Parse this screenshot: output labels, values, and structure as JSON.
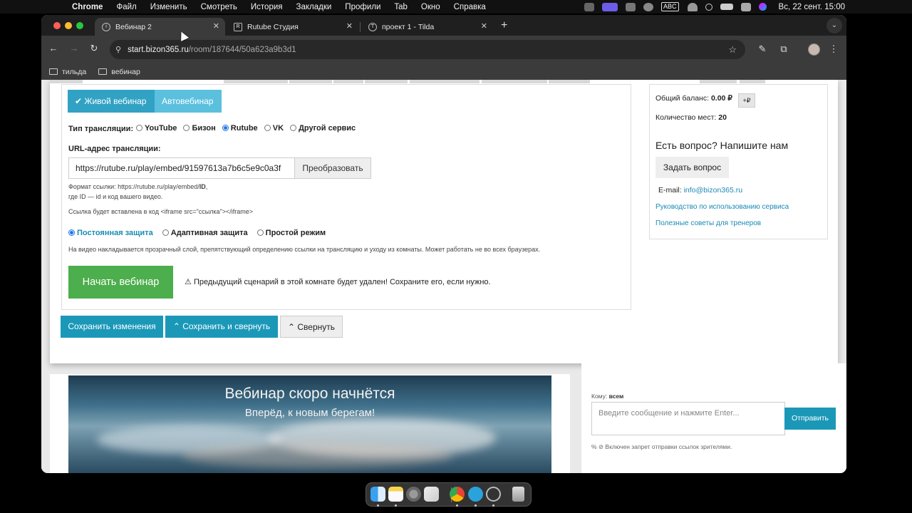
{
  "menubar": {
    "apple_glyph": "",
    "app": "Chrome",
    "items": [
      "Файл",
      "Изменить",
      "Смотреть",
      "История",
      "Закладки",
      "Профили",
      "Tab",
      "Окно",
      "Справка"
    ],
    "input_source": "ABC",
    "clock": "Вс, 22 сент.  15:00"
  },
  "browser": {
    "tabs": [
      {
        "title": "Вебинар 2",
        "favicon": "i",
        "active": true
      },
      {
        "title": "Rutube Студия",
        "favicon": "R",
        "active": false
      },
      {
        "title": "проект 1 - Tilda",
        "favicon": "T",
        "active": false
      }
    ],
    "new_tab_glyph": "+",
    "tab_close_glyph": "✕",
    "tab_search_glyph": "⌄",
    "url_host": "start.bizon365.ru",
    "url_path": "/room/187644/50a623a9b3d1",
    "bookmarks": [
      "тильда",
      "вебинар"
    ],
    "icons": {
      "back": "←",
      "forward": "→",
      "reload": "↻",
      "site": "⚲",
      "star": "☆",
      "pen": "✎",
      "extensions": "⧉",
      "menu": "⋮"
    }
  },
  "settings": {
    "mode_live": "✔ Живой вебинар",
    "mode_auto": "Автовебинар",
    "broadcast_type_label": "Тип трансляции:",
    "broadcast_options": [
      "YouTube",
      "Бизон",
      "Rutube",
      "VK",
      "Другой сервис"
    ],
    "broadcast_selected": "Rutube",
    "url_label": "URL-адрес трансляции:",
    "url_value": "https://rutube.ru/play/embed/91597613a7b6c5e9c0a3f",
    "convert_button": "Преобразовать",
    "hint_format_prefix": "Формат ссылки: https://rutube.ru/play/embed/",
    "hint_format_id": "ID",
    "hint_format_suffix": ",",
    "hint_id": "где ID — id и код вашего видео.",
    "hint_iframe": "Ссылка будет вставлена в код <iframe src=\"ссылка\"></iframe>",
    "protection_options": [
      "Постоянная защита",
      "Адаптивная защита",
      "Простой режим"
    ],
    "protection_selected": "Постоянная защита",
    "protection_hint": "На видео накладывается прозрачный слой, препятствующий определению ссылки на трансляцию и уходу из комнаты. Может работать не во всех браузерах.",
    "start_button": "Начать вебинар",
    "warning_icon": "⚠",
    "warning_text": "Предыдущий сценарий в этой комнате будет удален! Сохраните его, если нужно."
  },
  "actions": {
    "save": "Сохранить изменения",
    "save_collapse": "⌃ Сохранить и свернуть",
    "collapse": "⌃ Свернуть"
  },
  "sidebar": {
    "balance_label": "Общий баланс:",
    "balance_value": "0.00 ₽",
    "plus_button": "+₽",
    "seats_label": "Количество мест:",
    "seats_value": "20",
    "question_heading": "Есть вопрос? Напишите нам",
    "ask_button": "Задать вопрос",
    "email_label": "E-mail:",
    "email_value": "info@bizon365.ru",
    "link_manual": "Руководство по использованию сервиса",
    "link_tips": "Полезные советы для тренеров"
  },
  "video": {
    "title": "Вебинар скоро начнётся",
    "subtitle": "Вперёд, к новым берегам!"
  },
  "chat": {
    "to_label": "Кому:",
    "to_value": "всем",
    "placeholder": "Введите сообщение и нажмите Enter...",
    "send_button": "Отправить",
    "note": "% ⊘ Включен запрет отправки ссылок зрителями."
  },
  "colors": {
    "primary_blue": "#1b98b8",
    "live_blue": "#31a2c4",
    "auto_blue": "#5bc0de",
    "start_green": "#4cae4c",
    "link_blue": "#1b8ab3"
  }
}
